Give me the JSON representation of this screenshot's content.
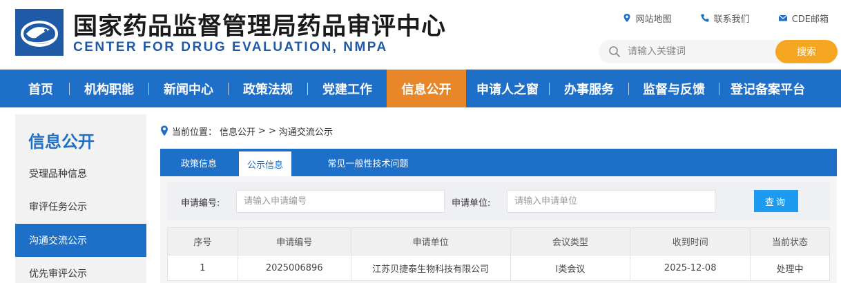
{
  "header": {
    "title_cn": "国家药品监督管理局药品审评中心",
    "title_en": "CENTER FOR DRUG EVALUATION, NMPA",
    "top_links": [
      {
        "label": "网站地图",
        "icon": "location-pin-icon"
      },
      {
        "label": "联系我们",
        "icon": "phone-icon"
      },
      {
        "label": "CDE邮箱",
        "icon": "mail-icon"
      }
    ],
    "search": {
      "placeholder": "请输入关键词",
      "button": "搜索"
    }
  },
  "nav": {
    "items": [
      "首页",
      "机构职能",
      "新闻中心",
      "政策法规",
      "党建工作",
      "信息公开",
      "申请人之窗",
      "办事服务",
      "监督与反馈",
      "登记备案平台"
    ],
    "active": "信息公开"
  },
  "sidebar": {
    "title": "信息公开",
    "items": [
      "受理品种信息",
      "审评任务公示",
      "沟通交流公示",
      "优先审评公示"
    ],
    "active": "沟通交流公示"
  },
  "breadcrumb": {
    "prefix": "当前位置：",
    "path": [
      "信息公开",
      ">",
      ">",
      "沟通交流公示"
    ]
  },
  "tabs": {
    "items": [
      "政策信息",
      "公示信息",
      "常见一般性技术问题"
    ],
    "active": "公示信息"
  },
  "filter": {
    "app_no_label": "申请编号:",
    "app_no_placeholder": "请输入申请编号",
    "applicant_label": "申请单位:",
    "applicant_placeholder": "请输入申请单位",
    "query_button": "查询"
  },
  "table": {
    "columns": [
      "序号",
      "申请编号",
      "申请单位",
      "会议类型",
      "收到时间",
      "当前状态"
    ],
    "rows": [
      [
        "1",
        "2025006896",
        "江苏贝捷泰生物科技有限公司",
        "I类会议",
        "2025-12-08",
        "处理中"
      ]
    ]
  },
  "colors": {
    "brand_blue": "#1e6fc7",
    "active_orange": "#e8862a",
    "search_orange": "#f5a623",
    "query_blue": "#1e9bf0"
  }
}
